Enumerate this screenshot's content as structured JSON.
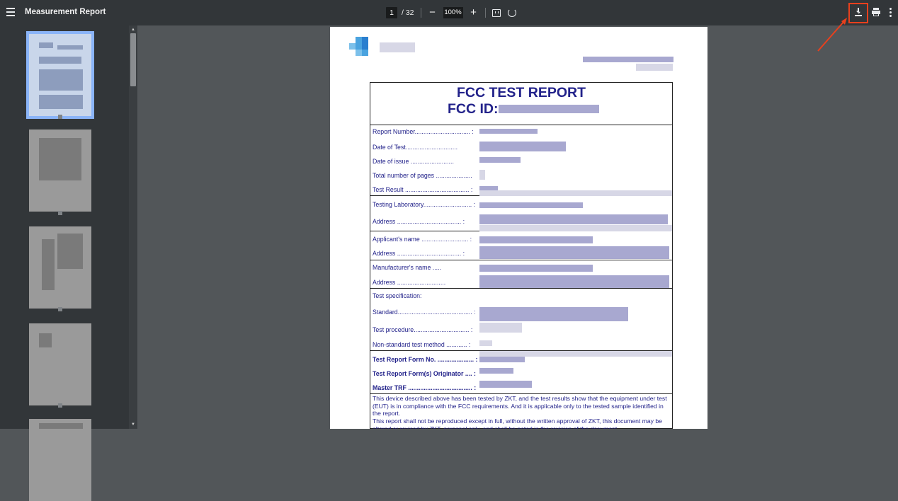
{
  "toolbar": {
    "title": "Measurement Report",
    "page_current": "1",
    "page_total": "/ 32",
    "zoom": "100%",
    "zoom_out": "−",
    "zoom_in": "+"
  },
  "report": {
    "title": "FCC TEST REPORT",
    "fcc_id_label": "FCC ID:",
    "fields": [
      "Report Number................................ :",
      "Date of Test..............................",
      "Date of issue .........................",
      "Total number of pages .....................",
      "Test Result  ..................................... :",
      "Testing Laboratory............................ :",
      "Address  ..................................... :",
      "Applicant's name  ........................... :",
      "Address  ..................................... :",
      "Manufacturer's name  .....",
      "Address  ............................",
      "Test specification:",
      "Standard........................................... :",
      "Test procedure................................ :",
      "Non-standard test method  ............ :"
    ],
    "bold_fields": [
      "Test Report Form No. ..................... :",
      "Test Report Form(s) Originator .... :",
      "Master TRF  ..................................... :"
    ],
    "paragraph1": "This device described above has been tested by ZKT, and the test results show that the equipment under test (EUT) is in compliance with the FCC requirements. And it is applicable only to the tested sample identified in the report.",
    "paragraph2": "This report shall not be reproduced except in full, without the written approval of ZKT, this document may be altered or revised by ZKT, personal only, and shall be noted in the revision of the document."
  }
}
